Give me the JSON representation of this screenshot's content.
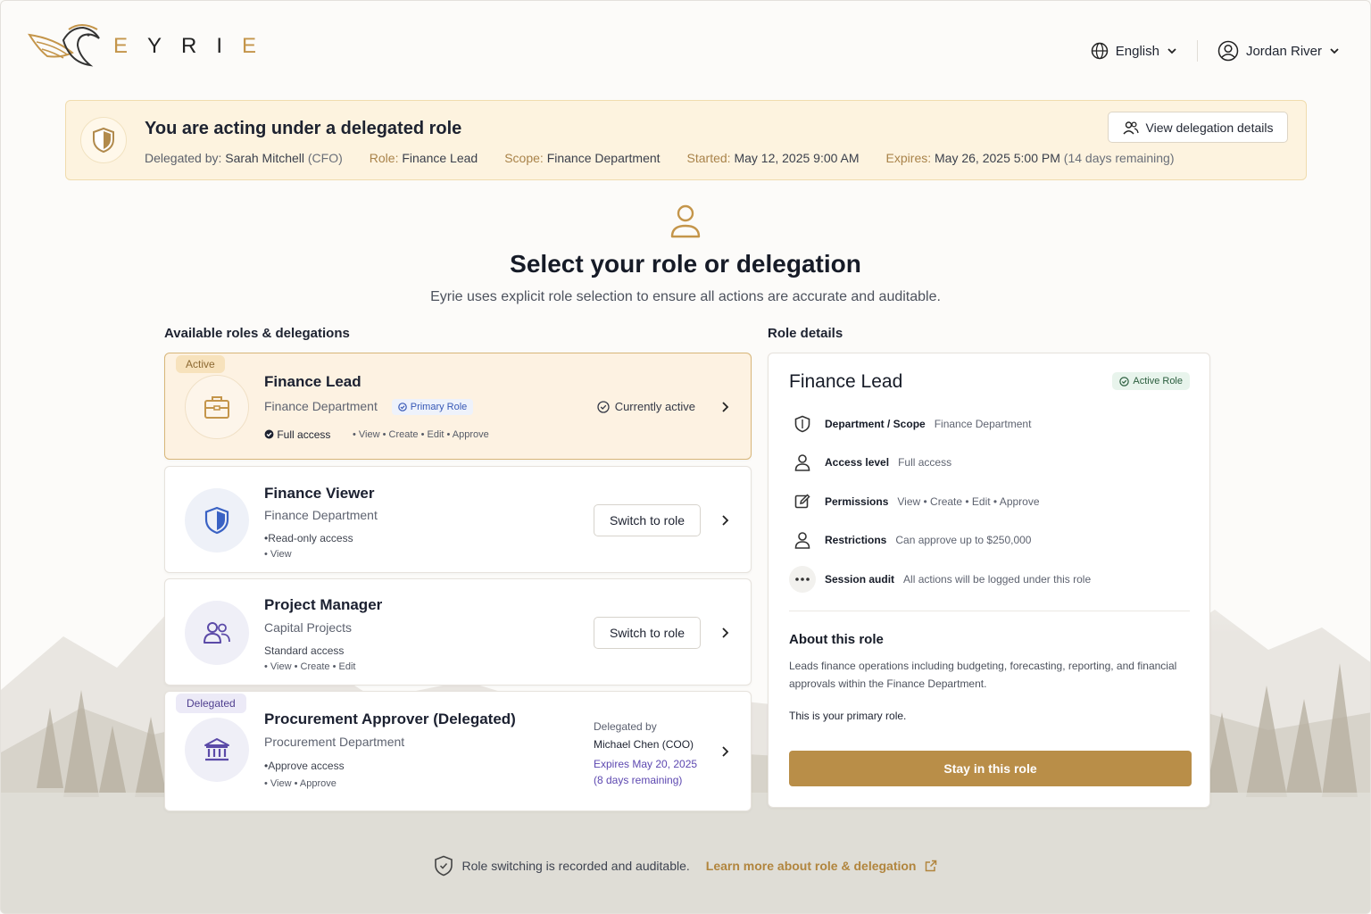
{
  "brand": {
    "name": [
      "E",
      "Y",
      "R",
      "I",
      "E"
    ]
  },
  "header": {
    "language": "English",
    "user": "Jordan River"
  },
  "banner": {
    "title": "You are acting under a delegated role",
    "delegated_by_label": "Delegated by:",
    "delegated_by": "Sarah Mitchell",
    "delegated_by_role": "(CFO)",
    "role_label": "Role:",
    "role": "Finance Lead",
    "scope_label": "Scope:",
    "scope": "Finance Department",
    "started_label": "Started:",
    "started": "May 12, 2025 9:00 AM",
    "expires_label": "Expires:",
    "expires": "May 26, 2025 5:00 PM",
    "remaining": "(14 days remaining)",
    "button": "View delegation details"
  },
  "hero": {
    "title": "Select your role or delegation",
    "subtitle": "Eyrie uses explicit role selection to ensure all actions are accurate and auditable."
  },
  "roles_section": {
    "label": "Available roles & delegations",
    "roles": [
      {
        "tag": "Active",
        "title": "Finance Lead",
        "dept": "Finance Department",
        "pill": "Primary Role",
        "access": "Full access",
        "perms": "• View • Create • Edit • Approve",
        "status": "Currently active"
      },
      {
        "title": "Finance Viewer",
        "dept": "Finance Department",
        "access": "•Read-only access",
        "perms": "• View",
        "button": "Switch to role"
      },
      {
        "title": "Project Manager",
        "dept": "Capital Projects",
        "access": "Standard access",
        "perms": "• View • Create • Edit",
        "button": "Switch to role"
      },
      {
        "tag": "Delegated",
        "title": "Procurement Approver (Delegated)",
        "dept": "Procurement Department",
        "access": "•Approve access",
        "perms": "• View • Approve",
        "delegated_by_label": "Delegated by",
        "delegated_by": "Michael Chen (COO)",
        "expires": "Expires May 20, 2025",
        "remaining": "(8 days remaining)"
      }
    ]
  },
  "details": {
    "label": "Role details",
    "title": "Finance Lead",
    "badge": "Active Role",
    "rows": [
      {
        "key": "Department / Scope",
        "value": "Finance Department"
      },
      {
        "key": "Access level",
        "value": "Full access"
      },
      {
        "key": "Permissions",
        "value": "View • Create • Edit • Approve"
      },
      {
        "key": "Restrictions",
        "value": "Can approve up to $250,000"
      },
      {
        "key": "Session audit",
        "value": "All actions will be logged under this role"
      }
    ],
    "about_title": "About this role",
    "about_text": "Leads finance operations including budgeting, forecasting, reporting, and financial approvals within the Finance Department.",
    "primary_note": "This is your primary role.",
    "button": "Stay in this role"
  },
  "footer": {
    "text": "Role switching is recorded and auditable.",
    "link": "Learn more about role & delegation"
  },
  "colors": {
    "accent": "#b98e48",
    "banner_bg": "#fdf3df",
    "delegated": "#5d48b0"
  }
}
